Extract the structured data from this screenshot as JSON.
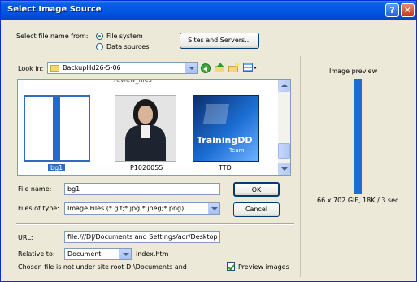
{
  "window": {
    "title": "Select Image Source"
  },
  "titlebar": {
    "help_glyph": "?",
    "close_glyph": "✕"
  },
  "select_from": {
    "label": "Select file name from:",
    "options": [
      "File system",
      "Data sources"
    ],
    "selected": "File system"
  },
  "sites_button": "Sites and Servers...",
  "look_in": {
    "label": "Look in:",
    "value": "BackupHd26-5-06"
  },
  "file_list": {
    "partial_top_label": "review_files",
    "items": [
      {
        "name": "bg1",
        "selected": true
      },
      {
        "name": "P1020055",
        "selected": false
      },
      {
        "name": "TTD",
        "selected": false
      }
    ],
    "ttd_logo_text": "TrainingDD",
    "ttd_logo_sub": "Team"
  },
  "file_name": {
    "label": "File name:",
    "value": "bg1"
  },
  "files_of_type": {
    "label": "Files of type:",
    "value": "Image Files (*.gif;*.jpg;*.jpeg;*.png)"
  },
  "ok_button": "OK",
  "cancel_button": "Cancel",
  "url": {
    "label": "URL:",
    "value": "file:///D|/Documents and Settings/aor/Desktop"
  },
  "relative_to": {
    "label": "Relative to:",
    "value": "Document",
    "page": "index.htm"
  },
  "status_text": "Chosen file is not under site root D:\\Documents and",
  "preview_images": {
    "label": "Preview images",
    "checked": true
  },
  "preview": {
    "title": "Image preview",
    "info": "66 x 702 GIF, 18K / 3 sec",
    "accent": "#1f6bd0"
  },
  "colors": {
    "titlebar": "#0054e3",
    "dialog": "#ece9d8",
    "selection": "#316ac5"
  }
}
